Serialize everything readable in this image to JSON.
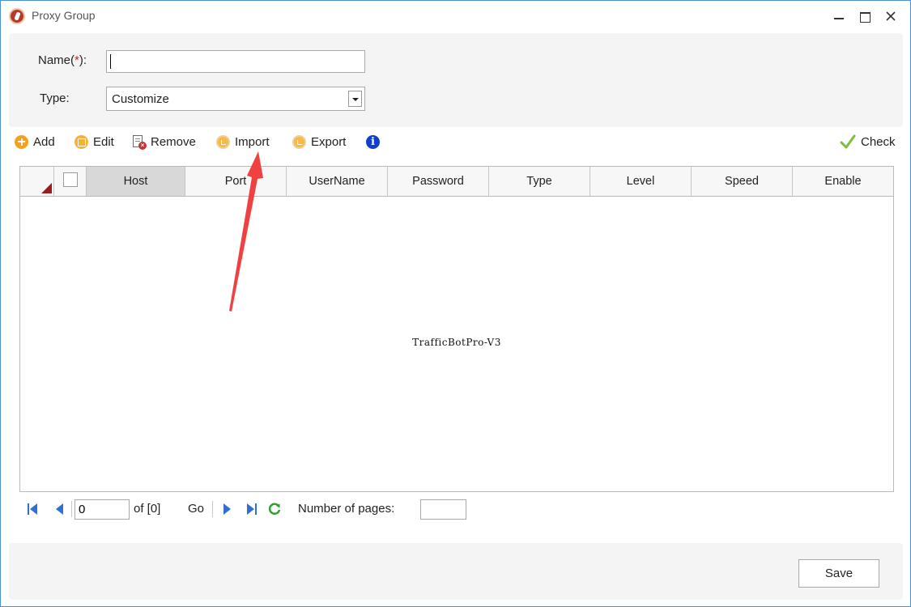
{
  "window": {
    "title": "Proxy Group"
  },
  "form": {
    "name_label": "Name(",
    "name_required": "*",
    "name_label_end": "):",
    "name_value": "",
    "type_label": "Type:",
    "type_value": "Customize"
  },
  "toolbar": {
    "add": "Add",
    "edit": "Edit",
    "remove": "Remove",
    "import": "Import",
    "export": "Export",
    "check": "Check"
  },
  "grid": {
    "columns": [
      "Host",
      "Port",
      "UserName",
      "Password",
      "Type",
      "Level",
      "Speed",
      "Enable"
    ],
    "rows": [],
    "watermark": "TrafficBotPro-V3"
  },
  "pager": {
    "current_page": "0",
    "of_text": "of [0]",
    "go_label": "Go",
    "pages_label": "Number of pages:",
    "pages_value": ""
  },
  "footer": {
    "save_label": "Save"
  },
  "colors": {
    "accent_blue": "#2f6fd0",
    "annotation_red": "#f04040",
    "add_orange": "#f5a020",
    "check_green": "#7cc03a"
  }
}
